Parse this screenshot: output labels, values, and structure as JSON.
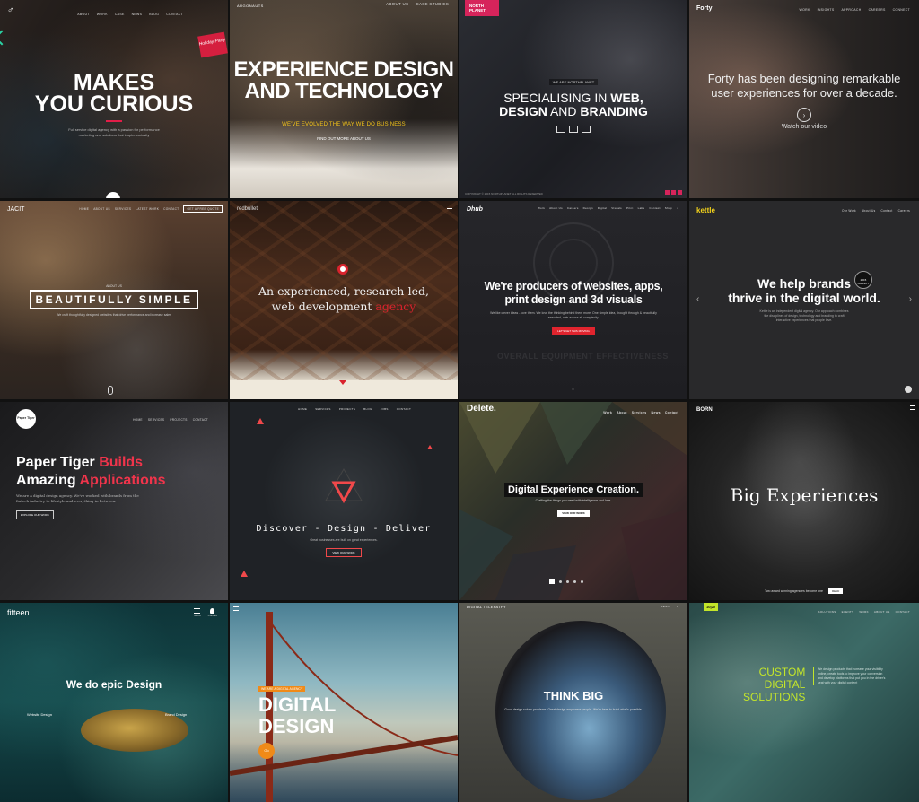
{
  "tiles": [
    {
      "id": "makes-you-curious",
      "headline": [
        "MAKES",
        "YOU CURIOUS"
      ],
      "sub": "Full service digital agency with a passion for performance marketing and solutions that inspire curiosity",
      "nav": [
        "ABOUT",
        "WORK",
        "CASE",
        "NEWS",
        "BLOG",
        "CONTACT"
      ],
      "badge": "Holiday Party",
      "accent": "#e11d48"
    },
    {
      "id": "experience-design",
      "logo": "ARGONAUTS",
      "nav": [
        "ABOUT US",
        "CASE STUDIES"
      ],
      "headline": [
        "EXPERIENCE DESIGN",
        "AND TECHNOLOGY"
      ],
      "sub": "WE'VE EVOLVED THE WAY WE DO BUSINESS",
      "cta": "FIND OUT MORE ABOUT US",
      "accent": "#f5c518"
    },
    {
      "id": "northplanet",
      "logo": "NORTH PLANET",
      "tag": "WE ARE NORTHPLANET",
      "headline_pre": "SPECIALISING IN ",
      "headline_b1": "WEB,",
      "headline_b2": "DESIGN",
      "headline_mid": " AND ",
      "headline_b3": "BRANDING",
      "footer": "COPYRIGHT © 2015 NORTHPLANET ALL RIGHTS RESERVED",
      "accent": "#d6245b"
    },
    {
      "id": "forty",
      "logo": "Forty",
      "nav": [
        "WORK",
        "INSIGHTS",
        "APPROACH",
        "CAREERS",
        "CONNECT"
      ],
      "headline": "Forty has been designing remarkable user experiences for over a decade.",
      "cta": "Watch our video"
    },
    {
      "id": "jacit",
      "logo": "JACIT",
      "nav": [
        "HOME",
        "ABOUT US",
        "SERVICES",
        "LATEST WORK",
        "CONTACT"
      ],
      "nav_cta": "GET A FREE QUOTE",
      "tag": "ABOUT US",
      "headline": "BEAUTIFULLY SIMPLE",
      "sub": "We craft thoughtfully designed websites that drive performance and increase sales"
    },
    {
      "id": "redbullet",
      "logo": "redbullet",
      "headline_pre": "An experienced, research-led, web development ",
      "headline_accent": "agency",
      "accent": "#d9232d"
    },
    {
      "id": "dhub",
      "logo": "Dhub",
      "nav": [
        "Work",
        "About Us",
        "Careers",
        "Design",
        "Digital",
        "Visuals",
        "Print",
        "Labs",
        "Contact",
        "Shop"
      ],
      "headline": [
        "We're producers of websites, apps,",
        "print design and 3d visuals"
      ],
      "sub": "We like clever ideas - love them. We love the thinking behind them more. One simple idea, thought through & beautifully executed, cuts across all complexity.",
      "cta": "LET'S GET THIS MOVING",
      "watermark": "OVERALL EQUIPMENT EFFECTIVENESS",
      "accent": "#e0242e"
    },
    {
      "id": "kettle",
      "logo": "kettle",
      "nav": [
        "Our Work",
        "About Us",
        "Contact",
        "Careers"
      ],
      "headline": [
        "We help brands",
        "thrive in the digital world."
      ],
      "badge": "2015 AGENCY",
      "sub": "Kettle is an independent digital agency. Our approach combines the disciplines of design, technology and branding to craft interactive experiences that people love.",
      "accent": "#f2d21b"
    },
    {
      "id": "paper-tiger",
      "logo": "Paper Tiger",
      "nav": [
        "HOME",
        "SERVICES",
        "PROJECTS",
        "CONTACT"
      ],
      "headline_1_pre": "Paper Tiger ",
      "headline_1_accent": "Builds",
      "headline_2_pre": "Amazing ",
      "headline_2_accent": "Applications",
      "sub": "We are a digital design agency. We've worked with brands from the fintech industry to lifestyle and everything in between.",
      "cta": "EXPLORE OUR WORK",
      "accent": "#f0344b"
    },
    {
      "id": "discover",
      "nav": [
        "HOME",
        "SERVICES",
        "PROJECTS",
        "BLOG",
        "JOBS",
        "CONTACT"
      ],
      "headline": "Discover - Design - Deliver",
      "sub": "Great businesses are built on great experiences.",
      "cta": "VIEW OUR WORK",
      "accent": "#f0484a"
    },
    {
      "id": "delete",
      "logo": "Delete.",
      "nav": [
        "Work",
        "About",
        "Services",
        "News",
        "Contact"
      ],
      "headline": "Digital Experience Creation.",
      "sub": "Crafting the things you need with intelligence and love.",
      "cta": "VIEW OUR WORK"
    },
    {
      "id": "born",
      "logo": "BORN",
      "headline": "Big Experiences",
      "footer": "Two award winning agencies become one",
      "cta": "READ"
    },
    {
      "id": "fifteen",
      "logo": "fifteen",
      "nav": [
        "Menu",
        "Contact"
      ],
      "headline": "We do epic Design",
      "link_left": "Website Design",
      "link_right": "Brand Design"
    },
    {
      "id": "digital-design",
      "tag": "WE ARE A DIGITAL AGENCY",
      "headline": [
        "DIGITAL",
        "DESIGN"
      ],
      "cta": "Go",
      "accent": "#f08a18"
    },
    {
      "id": "think-big",
      "logo": "DIGITAL TELEPATHY",
      "nav": [
        "MENU"
      ],
      "headline": "THINK BIG",
      "sub": "Good design solves problems. Great design empowers people. We're here to build what's possible."
    },
    {
      "id": "custom-digital",
      "logo": "10|20",
      "nav": [
        "SOLUTIONS",
        "EVENTS",
        "WORK",
        "ABOUT US",
        "CONTACT"
      ],
      "headline": [
        "CUSTOM",
        "DIGITAL",
        "SOLUTIONS"
      ],
      "sub": "We design products that increase your visibility online, create tools to improve your conversion and develop platforms that put you in the driver's seat with your digital content",
      "accent": "#c3e52a"
    }
  ]
}
